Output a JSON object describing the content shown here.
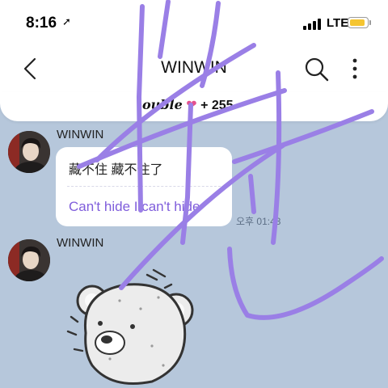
{
  "status_bar": {
    "time": "8:16",
    "location_icon": "location-arrow-icon",
    "network": "LTE",
    "battery_color": "#f5c531"
  },
  "header": {
    "title": "WINWIN",
    "back_icon": "chevron-left-icon",
    "search_icon": "search-icon",
    "more_icon": "more-vertical-icon"
  },
  "banner": {
    "name_fragment": "ouble",
    "heart_icon": "heart-icon",
    "count": "+ 255"
  },
  "messages": [
    {
      "sender": "WINWIN",
      "lines": [
        "藏不住 藏不住了",
        "Can't hide I can't hide"
      ],
      "time": "오후 01:43"
    },
    {
      "sender": "WINWIN",
      "type": "sticker",
      "sticker": "bear-sticker"
    }
  ],
  "colors": {
    "chat_background": "#b6c7db",
    "accent_purple": "#7f5ddb",
    "scribble": "#9a7fe6"
  }
}
